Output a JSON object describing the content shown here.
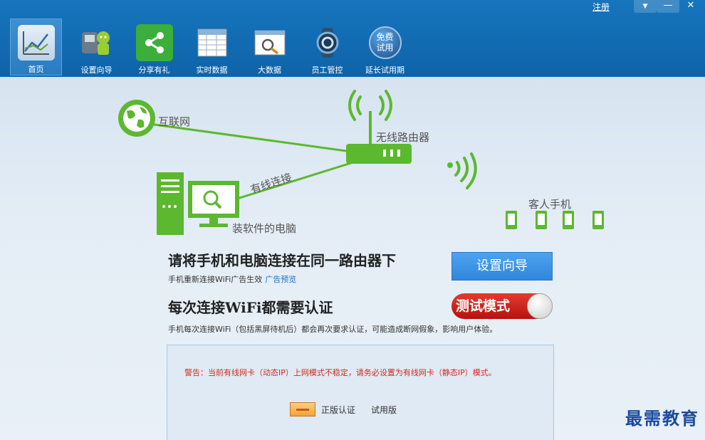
{
  "titlebar": {
    "register_label": "注册",
    "menu_glyph": "▼",
    "minimize_glyph": "—",
    "close_glyph": "✕"
  },
  "nav": [
    {
      "label": "首页",
      "icon": "chart-icon"
    },
    {
      "label": "设置向导",
      "icon": "robot-icon"
    },
    {
      "label": "分享有礼",
      "icon": "share-icon"
    },
    {
      "label": "实时数据",
      "icon": "table-icon"
    },
    {
      "label": "大数据",
      "icon": "magnifier-icon"
    },
    {
      "label": "员工管控",
      "icon": "watch-icon"
    },
    {
      "label": "延长试用期",
      "icon": "free-trial-icon",
      "badge": "免费\n试用"
    }
  ],
  "diagram": {
    "internet": "互联网",
    "router": "无线路由器",
    "wired": "有线连接",
    "pc": "装软件的电脑",
    "guest_phones": "客人手机"
  },
  "section1": {
    "heading": "请将手机和电脑连接在同一路由器下",
    "sub": "手机重新连接WiFi广告生效",
    "link": "广告预览",
    "button": "设置向导"
  },
  "section2": {
    "heading": "每次连接WiFi都需要认证",
    "sub": "手机每次连接WiFi（包括黑屏待机后）都会再次要求认证，可能造成断网假象，影响用户体验。",
    "toggle_label": "测试模式"
  },
  "panel": {
    "warning": "警告：当前有线网卡（动态IP）上网模式不稳定，请务必设置为有线网卡（静态IP）模式。",
    "auth_label": "正版认证",
    "trial_label": "试用版"
  },
  "watermark": "最需教育",
  "colors": {
    "green": "#5cb82e",
    "accent_blue": "#2f87dc",
    "warning_red": "#d42a1f",
    "toggle_red": "#c8211a"
  }
}
